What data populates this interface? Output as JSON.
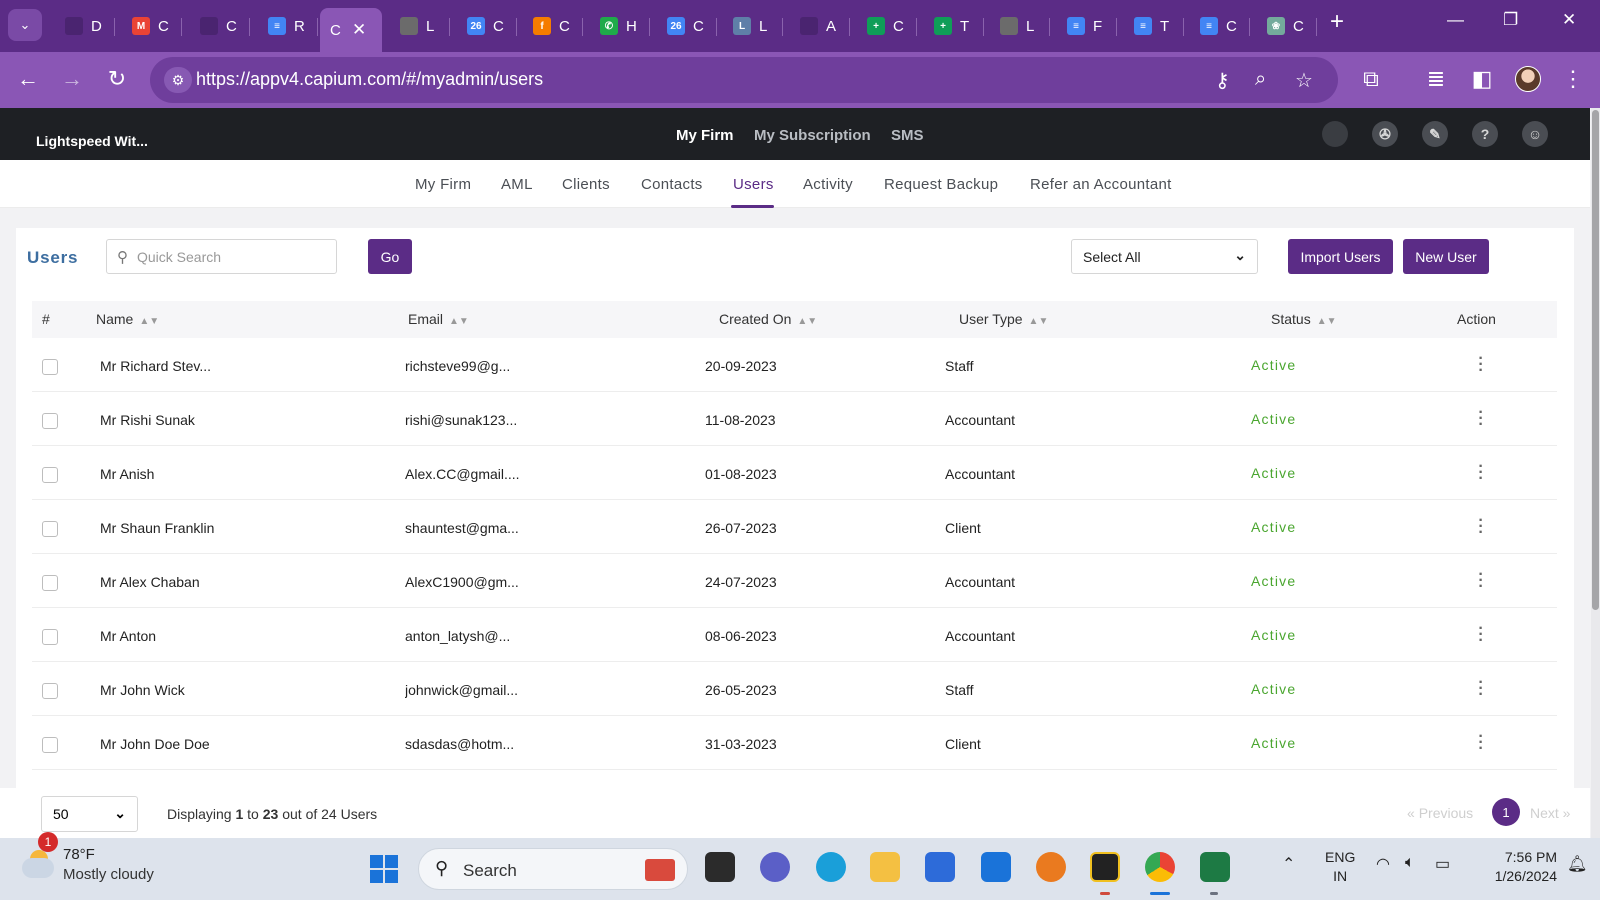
{
  "browser": {
    "tabs": [
      {
        "label": "D",
        "color": "#4a2470",
        "glyph": ""
      },
      {
        "label": "C",
        "color": "#ea4335",
        "glyph": "M"
      },
      {
        "label": "C",
        "color": "#4a2470",
        "glyph": ""
      },
      {
        "label": "R",
        "color": "#4285f4",
        "glyph": "≡"
      },
      {
        "label": "C",
        "color": "",
        "glyph": "",
        "active": true
      },
      {
        "label": "L",
        "color": "#6b6b6b",
        "glyph": ""
      },
      {
        "label": "C",
        "color": "#4285f4",
        "glyph": "26"
      },
      {
        "label": "C",
        "color": "#f57c00",
        "glyph": "f"
      },
      {
        "label": "H",
        "color": "#1faa4a",
        "glyph": "✆"
      },
      {
        "label": "C",
        "color": "#4285f4",
        "glyph": "26"
      },
      {
        "label": "L",
        "color": "#5f7fa8",
        "glyph": "L"
      },
      {
        "label": "A",
        "color": "#4a2470",
        "glyph": ""
      },
      {
        "label": "C",
        "color": "#0f9d58",
        "glyph": "+"
      },
      {
        "label": "T",
        "color": "#0f9d58",
        "glyph": "+"
      },
      {
        "label": "L",
        "color": "#6b6b6b",
        "glyph": ""
      },
      {
        "label": "F",
        "color": "#4285f4",
        "glyph": "≡"
      },
      {
        "label": "T",
        "color": "#4285f4",
        "glyph": "≡"
      },
      {
        "label": "C",
        "color": "#4285f4",
        "glyph": "≡"
      },
      {
        "label": "C",
        "color": "#74aa9c",
        "glyph": "❀"
      }
    ],
    "url": "https://appv4.capium.com/#/myadmin/users"
  },
  "app": {
    "firm_name": "Lightspeed Wit...",
    "top_nav": [
      "My Firm",
      "My Subscription",
      "SMS"
    ],
    "sub_nav": [
      "My Firm",
      "AML",
      "Clients",
      "Contacts",
      "Users",
      "Activity",
      "Request Backup",
      "Refer an Accountant"
    ],
    "active_sub_nav": "Users",
    "brand_color": "#5b2c86"
  },
  "users": {
    "title": "Users",
    "search_placeholder": "Quick Search",
    "go_label": "Go",
    "filter_selected": "Select All",
    "import_label": "Import Users",
    "new_label": "New User",
    "columns": [
      "#",
      "Name",
      "Email",
      "Created On",
      "User Type",
      "Status",
      "Action"
    ],
    "rows": [
      {
        "name": "Mr Richard Stev...",
        "email": "richsteve99@g...",
        "created": "20-09-2023",
        "type": "Staff",
        "status": "Active"
      },
      {
        "name": "Mr Rishi Sunak",
        "email": "rishi@sunak123...",
        "created": "11-08-2023",
        "type": "Accountant",
        "status": "Active"
      },
      {
        "name": "Mr Anish",
        "email": "Alex.CC@gmail....",
        "created": "01-08-2023",
        "type": "Accountant",
        "status": "Active"
      },
      {
        "name": "Mr Shaun Franklin",
        "email": "shauntest@gma...",
        "created": "26-07-2023",
        "type": "Client",
        "status": "Active"
      },
      {
        "name": "Mr Alex Chaban",
        "email": "AlexC1900@gm...",
        "created": "24-07-2023",
        "type": "Accountant",
        "status": "Active"
      },
      {
        "name": "Mr Anton",
        "email": "anton_latysh@...",
        "created": "08-06-2023",
        "type": "Accountant",
        "status": "Active"
      },
      {
        "name": "Mr John Wick",
        "email": "johnwick@gmail...",
        "created": "26-05-2023",
        "type": "Staff",
        "status": "Active"
      },
      {
        "name": "Mr John Doe Doe",
        "email": "sdasdas@hotm...",
        "created": "31-03-2023",
        "type": "Client",
        "status": "Active"
      }
    ],
    "footer": {
      "page_size": "50",
      "displaying_prefix": "Displaying",
      "range_from": "1",
      "range_to_word": "to",
      "range_to": "23",
      "total_text": "out of 24 Users",
      "previous_label": "Previous",
      "next_label": "Next",
      "current_page": "1"
    }
  },
  "taskbar": {
    "weather_temp": "78°F",
    "weather_condition": "Mostly cloudy",
    "weather_badge": "1",
    "search_label": "Search",
    "lang_line1": "ENG",
    "lang_line2": "IN",
    "time": "7:56 PM",
    "date": "1/26/2024"
  }
}
